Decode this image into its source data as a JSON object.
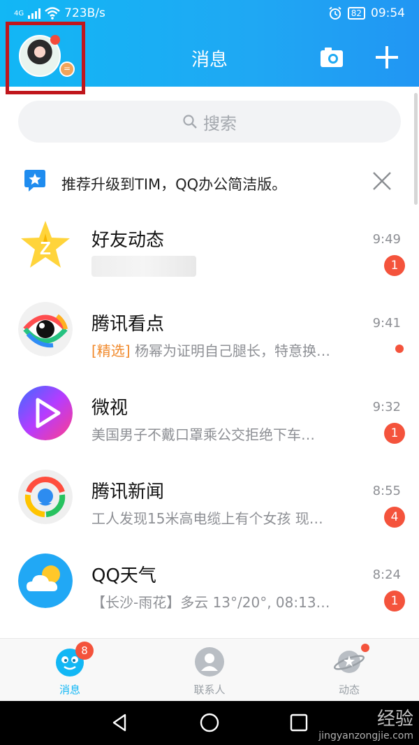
{
  "status_bar": {
    "network": "4G",
    "speed": "723B/s",
    "battery": "82",
    "time": "09:54"
  },
  "header": {
    "title": "消息",
    "avatar_badge": "="
  },
  "search": {
    "placeholder": "搜索"
  },
  "banner": {
    "text": "推荐升级到TIM，QQ办公简洁版。"
  },
  "conversations": [
    {
      "name": "好友动态",
      "tag": "",
      "preview": "",
      "time": "9:49",
      "badge": "1",
      "icon": "qzone-star-icon"
    },
    {
      "name": "腾讯看点",
      "tag": "[精选]",
      "preview": " 杨幂为证明自己腿长，特意换…",
      "time": "9:41",
      "badge": "",
      "icon": "kandian-eye-icon"
    },
    {
      "name": "微视",
      "tag": "",
      "preview": "美国男子不戴口罩乘公交拒绝下车…",
      "time": "9:32",
      "badge": "1",
      "icon": "weishi-play-icon"
    },
    {
      "name": "腾讯新闻",
      "tag": "",
      "preview": "工人发现15米高电缆上有个女孩 现…",
      "time": "8:55",
      "badge": "4",
      "icon": "tencent-news-icon"
    },
    {
      "name": "QQ天气",
      "tag": "",
      "preview": "【长沙-雨花】多云 13°/20°, 08:13…",
      "time": "8:24",
      "badge": "1",
      "icon": "weather-cloud-icon"
    }
  ],
  "tabs": [
    {
      "label": "消息",
      "badge": "8"
    },
    {
      "label": "联系人",
      "badge": ""
    },
    {
      "label": "动态",
      "badge": ""
    }
  ],
  "watermark": {
    "line1": "经验",
    "line2": "jingyanzongjie.com"
  },
  "colors": {
    "header": "#12b7f5",
    "badge": "#f4533c",
    "highlight_box": "#c0161c"
  }
}
